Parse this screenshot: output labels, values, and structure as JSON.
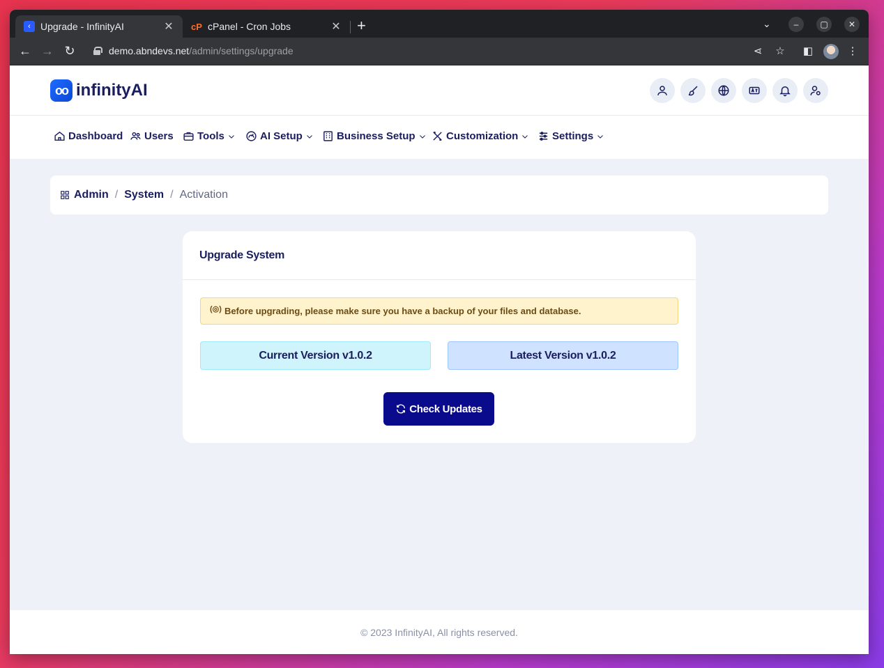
{
  "browser": {
    "tabs": [
      {
        "title": "Upgrade - InfinityAI",
        "favicon": "infinityai-favicon"
      },
      {
        "title": "cPanel - Cron Jobs",
        "favicon": "cpanel-favicon"
      }
    ],
    "url_host": "demo.abndevs.net",
    "url_path": "/admin/settings/upgrade"
  },
  "app": {
    "logo_mark": "oo",
    "logo_text": "infinityAI",
    "header_icons": [
      "user-icon",
      "brush-icon",
      "globe-icon",
      "language-icon",
      "bell-icon",
      "user-settings-icon"
    ],
    "menu": [
      {
        "label": "Dashboard",
        "icon": "home-icon",
        "dropdown": false
      },
      {
        "label": "Users",
        "icon": "users-icon",
        "dropdown": false
      },
      {
        "label": "Tools",
        "icon": "briefcase-icon",
        "dropdown": true
      },
      {
        "label": "AI Setup",
        "icon": "gauge-icon",
        "dropdown": true
      },
      {
        "label": "Business Setup",
        "icon": "building-icon",
        "dropdown": true
      },
      {
        "label": "Customization",
        "icon": "tools-icon",
        "dropdown": true
      },
      {
        "label": "Settings",
        "icon": "sliders-icon",
        "dropdown": true
      }
    ]
  },
  "breadcrumb": {
    "items": [
      "Admin",
      "System"
    ],
    "current": "Activation",
    "separator": "/"
  },
  "upgrade_card": {
    "title": "Upgrade System",
    "alert": "Before upgrading, please make sure you have a backup of your files and database.",
    "current_version": "Current Version v1.0.2",
    "latest_version": "Latest Version v1.0.2",
    "check_button": "Check Updates"
  },
  "footer": {
    "text": "© 2023 InfinityAI, All rights reserved."
  }
}
